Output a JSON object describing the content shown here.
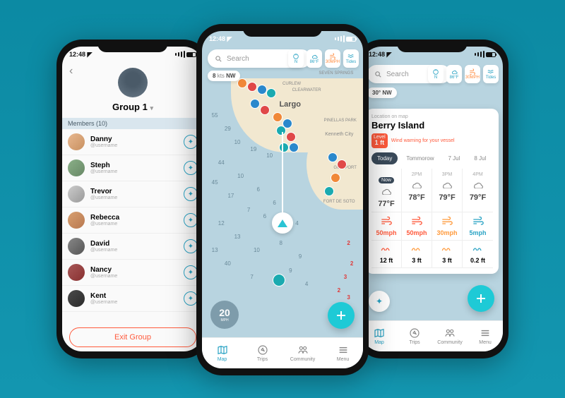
{
  "status": {
    "time": "12:48",
    "nav_icon": "◤"
  },
  "left_phone": {
    "title": "Group 1",
    "back_icon": "‹",
    "section": "Members (10)",
    "compass_icon": "✦",
    "members": [
      {
        "name": "Danny",
        "username": "@username"
      },
      {
        "name": "Steph",
        "username": "@username"
      },
      {
        "name": "Trevor",
        "username": "@username"
      },
      {
        "name": "Rebecca",
        "username": "@username"
      },
      {
        "name": "David",
        "username": "@username"
      },
      {
        "name": "Nancy",
        "username": "@username"
      },
      {
        "name": "Kent",
        "username": "@username"
      }
    ],
    "exit_label": "Exit Group"
  },
  "center_phone": {
    "search_placeholder": "Search",
    "compass_text": "N",
    "top_weather": "86°F",
    "top_wind": "30MPH",
    "top_tides": "Tides",
    "wind_label": "NW",
    "wind_speed": "8",
    "wind_unit": "kts",
    "speed_value": "20",
    "speed_unit": "MPH",
    "cities": {
      "seven_springs": "SEVEN SPRINGS",
      "largo": "Largo",
      "curlew": "CURLEW",
      "clearwater": "CLEARWATER",
      "pinellas": "PINELLAS PARK",
      "kenneth": "Kenneth City",
      "gulfport": "GULFPORT",
      "soto": "FORT DE SOTO"
    },
    "depths": [
      "55",
      "29",
      "10",
      "19",
      "10",
      "44",
      "10",
      "45",
      "6",
      "17",
      "6",
      "7",
      "6",
      "12",
      "4",
      "13",
      "8",
      "10",
      "9",
      "40",
      "13",
      "9",
      "7",
      "4"
    ],
    "red_nums": [
      "2",
      "2",
      "3",
      "2",
      "3"
    ],
    "tabs": [
      {
        "label": "Map"
      },
      {
        "label": "Trips"
      },
      {
        "label": "Community"
      },
      {
        "label": "Menu"
      }
    ]
  },
  "right_phone": {
    "search_placeholder": "Search",
    "compass_text": "N",
    "top_weather_label": "86°F",
    "top_wind_label": "30MPH",
    "top_tides_label": "Tides",
    "wind_dir": "30° NW",
    "loc_label": "Location on map",
    "loc_name": "Berry Island",
    "warn_top": "Level",
    "warn_val": "1 ft",
    "warn_text": "Wind warning for your vessel",
    "day_tabs": [
      "Today",
      "Tommorow",
      "7 Jul",
      "8 Jul"
    ],
    "hours": [
      "Now",
      "2PM",
      "3PM",
      "4PM"
    ],
    "temps": [
      "77°F",
      "78°F",
      "79°F",
      "79°F"
    ],
    "winds": [
      "50mph",
      "50mph",
      "30mph",
      "5mph"
    ],
    "wind_class": [
      "r",
      "r",
      "o",
      "b"
    ],
    "waves": [
      "12 ft",
      "3 ft",
      "3 ft",
      "0.2 ft"
    ],
    "wave_class": [
      "r",
      "o",
      "o",
      "b"
    ],
    "tabs": [
      {
        "label": "Map"
      },
      {
        "label": "Trips"
      },
      {
        "label": "Community"
      },
      {
        "label": "Menu"
      }
    ]
  }
}
